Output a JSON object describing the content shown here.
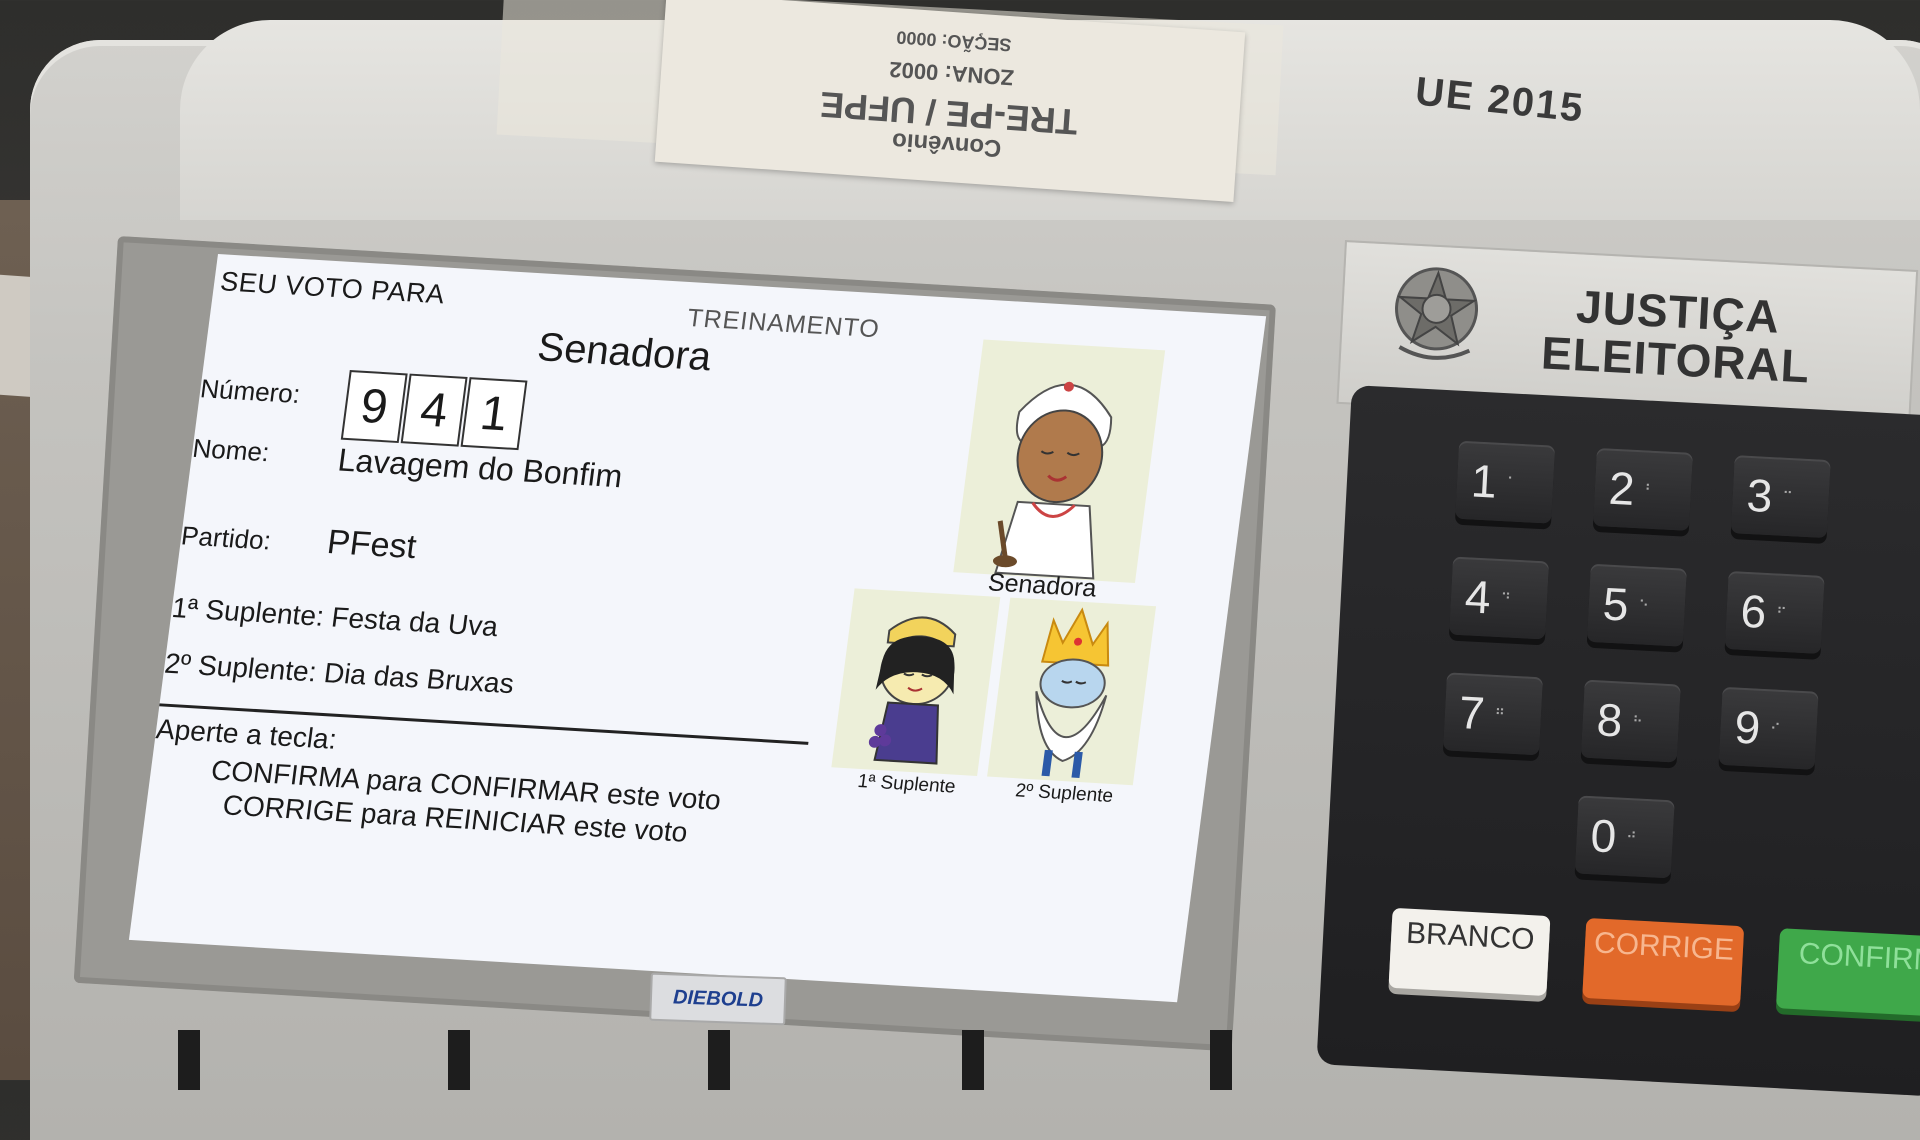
{
  "sticker": {
    "line1": "Convênio",
    "line2": "TRE-PE / UFPE",
    "line3": "ZONA: 0002",
    "line4": "SEÇÃO: 0000"
  },
  "machine_label": "UE 2015",
  "screen": {
    "header": "SEU VOTO PARA",
    "mode": "TREINAMENTO",
    "office": "Senadora",
    "number_label": "Número:",
    "number_digits": [
      "9",
      "4",
      "1"
    ],
    "name_label": "Nome:",
    "name_value": "Lavagem do Bonfim",
    "party_label": "Partido:",
    "party_value": "PFest",
    "substitute1": "1ª Suplente: Festa da Uva",
    "substitute2": "2º Suplente: Dia das Bruxas",
    "instructions": {
      "title": "Aperte a tecla:",
      "confirm": "CONFIRMA para CONFIRMAR este voto",
      "correct": "CORRIGE para REINICIAR este voto"
    },
    "photo_captions": {
      "main": "Senadora",
      "sub1": "1ª Suplente",
      "sub2": "2º Suplente"
    }
  },
  "brand": "DIEBOLD",
  "panel": {
    "line1": "JUSTIÇA",
    "line2": "ELEITORAL"
  },
  "keypad": {
    "digits": [
      "1",
      "2",
      "3",
      "4",
      "5",
      "6",
      "7",
      "8",
      "9",
      "0"
    ],
    "branco": "BRANCO",
    "corrige": "CORRIGE",
    "confirma": "CONFIRMA"
  },
  "colors": {
    "screen_bg": "#f4f6fb",
    "corrige_key": "#e2692a",
    "confirma_key": "#3fa84a",
    "branco_key": "#f3f1ec"
  }
}
